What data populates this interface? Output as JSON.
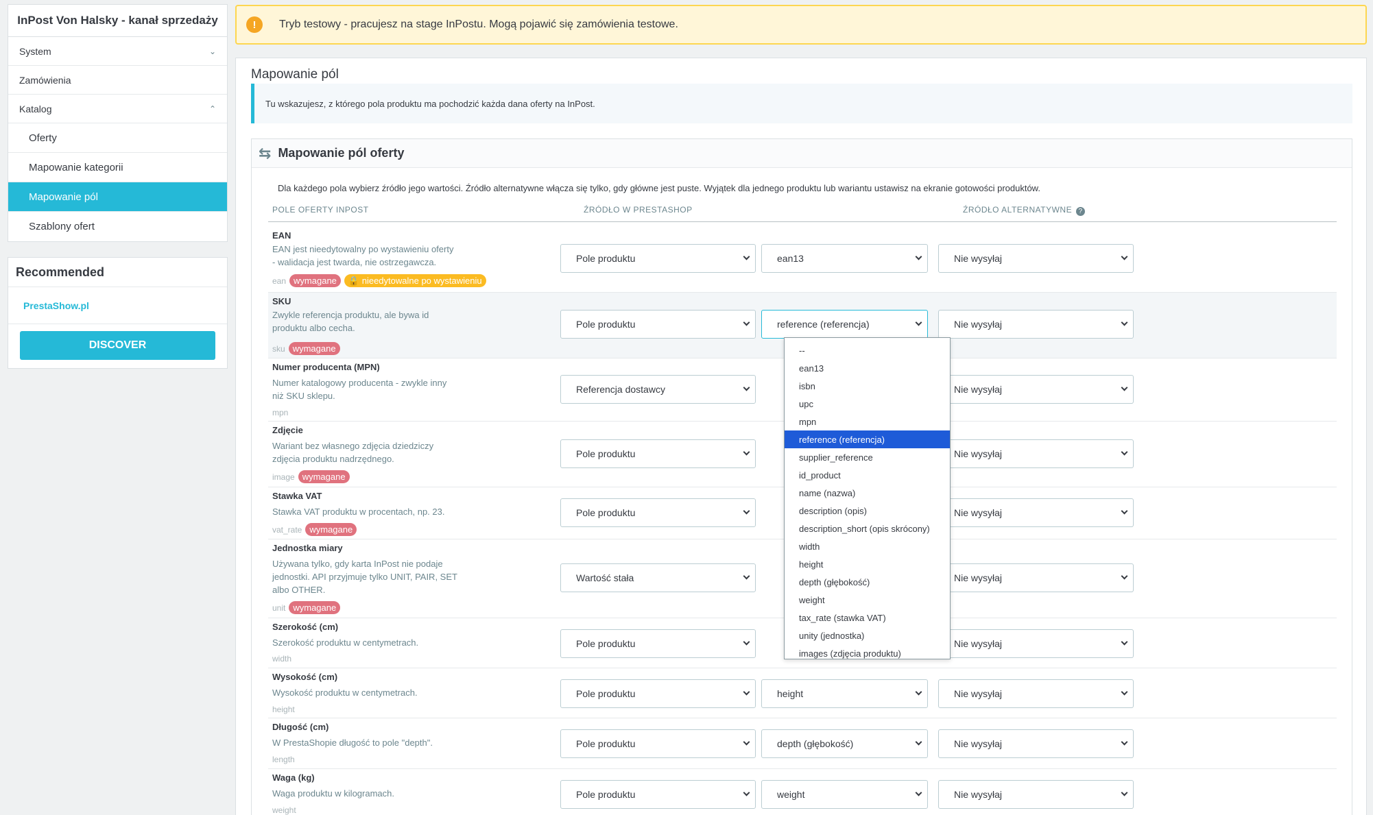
{
  "sidebar": {
    "title": "InPost Von Halsky - kanał sprzedaży",
    "items": [
      {
        "label": "System",
        "chevron": "down"
      },
      {
        "label": "Zamówienia"
      },
      {
        "label": "Katalog",
        "chevron": "up"
      }
    ],
    "subitems": [
      "Oferty",
      "Mapowanie kategorii",
      "Mapowanie pól",
      "Szablony ofert"
    ],
    "active": "Mapowanie pól",
    "recommended": {
      "title": "Recommended",
      "link": "PrestaShow.pl",
      "button": "DISCOVER"
    }
  },
  "alert": {
    "icon": "warning-icon",
    "text": "Tryb testowy - pracujesz na stage InPostu. Mogą pojawić się zamówienia testowe."
  },
  "panel": {
    "title": "Mapowanie pól",
    "info": "Tu wskazujesz, z którego pola produktu ma pochodzić każda dana oferty na InPost.",
    "card_title": "Mapowanie pól oferty",
    "card_desc": "Dla każdego pola wybierz źródło jego wartości. Źródło alternatywne włącza się tylko, gdy główne jest puste. Wyjątek dla jednego produktu lub wariantu ustawisz na ekranie gotowości produktów.",
    "col_field": "POLE OFERTY INPOST",
    "col_source": "ŹRÓDŁO W PRESTASHOP",
    "col_alt": "ŹRÓDŁO ALTERNATYWNE"
  },
  "rows": [
    {
      "name": "EAN",
      "desc": [
        "EAN jest nieedytowalny po wystawieniu oferty",
        "- walidacja jest twarda, nie ostrzegawcza."
      ],
      "key": "ean",
      "required": "wymagane",
      "lock": "nieedytowalne po wystawieniu",
      "source": "Pole produktu",
      "field": "ean13",
      "alt": "Nie wysyłaj"
    },
    {
      "name": "SKU",
      "desc": [
        "Zwykle referencja produktu, ale bywa id",
        "produktu albo cecha."
      ],
      "key": "sku",
      "required": "wymagane",
      "source": "Pole produktu",
      "field": "reference (referencja)",
      "alt": "Nie wysyłaj"
    },
    {
      "name": "Numer producenta (MPN)",
      "desc": [
        "Numer katalogowy producenta - zwykle inny",
        "niż SKU sklepu."
      ],
      "key": "mpn",
      "source": "Referencja dostawcy",
      "alt": "Nie wysyłaj"
    },
    {
      "name": "Zdjęcie",
      "desc": [
        "Wariant bez własnego zdjęcia dziedziczy",
        "zdjęcia produktu nadrzędnego."
      ],
      "key": "image",
      "required": "wymagane",
      "source": "Pole produktu",
      "alt": "Nie wysyłaj"
    },
    {
      "name": "Stawka VAT",
      "desc": [
        "Stawka VAT produktu w procentach, np. 23."
      ],
      "key": "vat_rate",
      "required": "wymagane",
      "source": "Pole produktu",
      "alt": "Nie wysyłaj"
    },
    {
      "name": "Jednostka miary",
      "desc": [
        "Używana tylko, gdy karta InPost nie podaje",
        "jednostki. API przyjmuje tylko UNIT, PAIR, SET",
        "albo OTHER."
      ],
      "key": "unit",
      "required": "wymagane",
      "source": "Wartość stała",
      "alt": "Nie wysyłaj"
    },
    {
      "name": "Szerokość (cm)",
      "desc": [
        "Szerokość produktu w centymetrach."
      ],
      "key": "width",
      "source": "Pole produktu",
      "alt": "Nie wysyłaj"
    },
    {
      "name": "Wysokość (cm)",
      "desc": [
        "Wysokość produktu w centymetrach."
      ],
      "key": "height",
      "source": "Pole produktu",
      "field": "height",
      "alt": "Nie wysyłaj"
    },
    {
      "name": "Długość (cm)",
      "desc": [
        "W PrestaShopie długość to pole \"depth\"."
      ],
      "key": "length",
      "source": "Pole produktu",
      "field": "depth (głębokość)",
      "alt": "Nie wysyłaj"
    },
    {
      "name": "Waga (kg)",
      "desc": [
        "Waga produktu w kilogramach."
      ],
      "key": "weight",
      "source": "Pole produktu",
      "field": "weight",
      "alt": "Nie wysyłaj"
    }
  ],
  "dropdown": {
    "options": [
      "--",
      "ean13",
      "isbn",
      "upc",
      "mpn",
      "reference (referencja)",
      "supplier_reference",
      "id_product",
      "name (nazwa)",
      "description (opis)",
      "description_short (opis skrócony)",
      "width",
      "height",
      "depth (głębokość)",
      "weight",
      "tax_rate (stawka VAT)",
      "unity (jednostka)",
      "images (zdjęcia produktu)"
    ],
    "selected": "reference (referencja)"
  }
}
